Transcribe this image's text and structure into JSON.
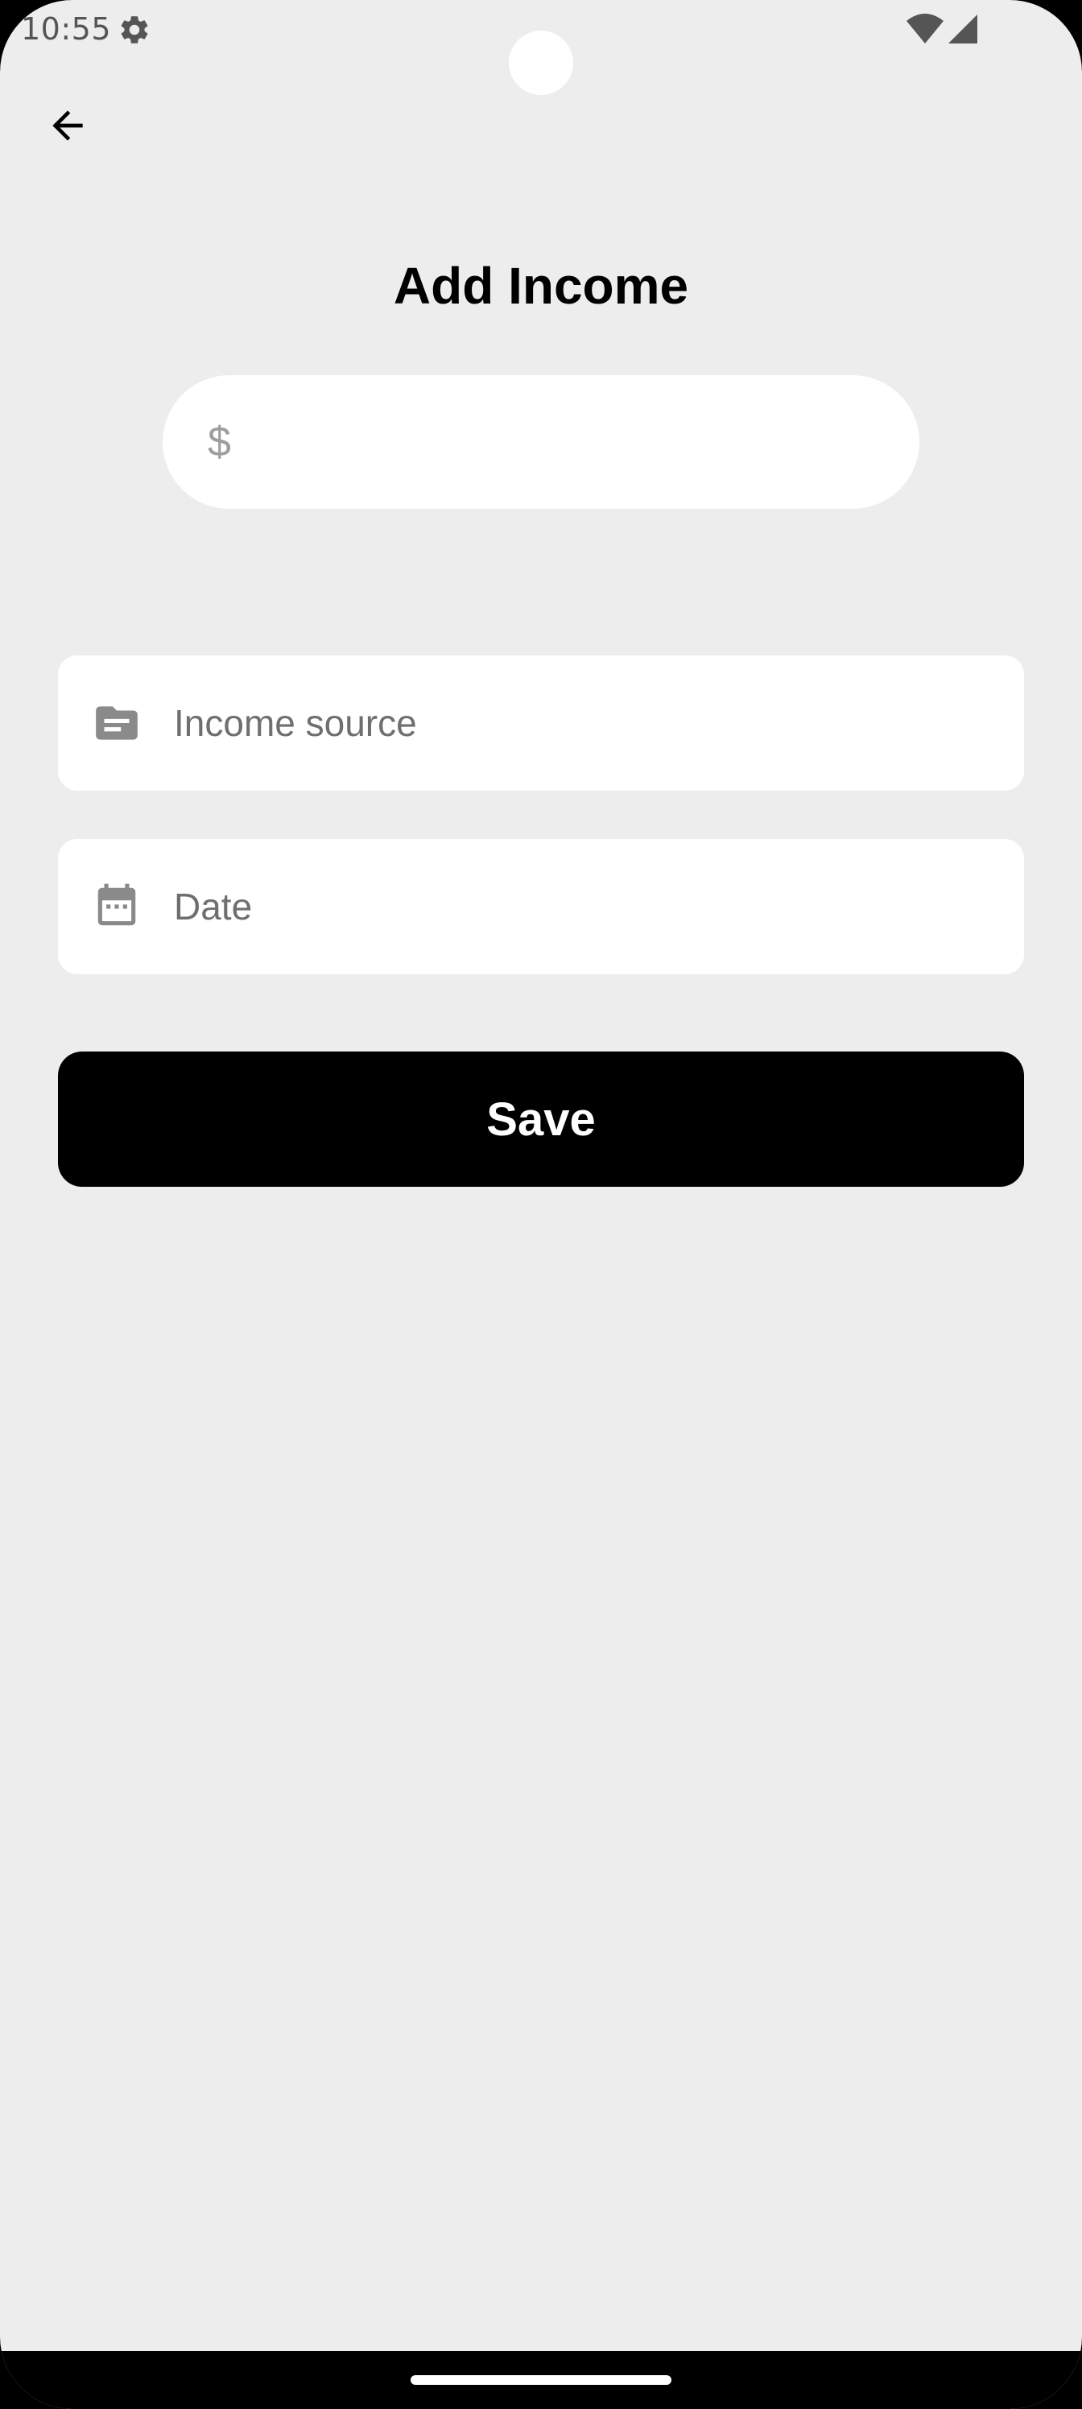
{
  "status_bar": {
    "time": "10:55",
    "icons": [
      "gear-icon",
      "wifi-icon",
      "signal-icon"
    ]
  },
  "header": {
    "back_icon": "arrow-left-icon",
    "title": "Add Income"
  },
  "form": {
    "amount": {
      "prefix": "$",
      "value": ""
    },
    "income_source": {
      "icon": "folder-icon",
      "placeholder": "Income source"
    },
    "date": {
      "icon": "calendar-icon",
      "placeholder": "Date"
    },
    "save_label": "Save"
  },
  "colors": {
    "background": "#ededed",
    "field_background": "#ffffff",
    "primary_button": "#000000",
    "placeholder_text": "#6f6f6f"
  }
}
